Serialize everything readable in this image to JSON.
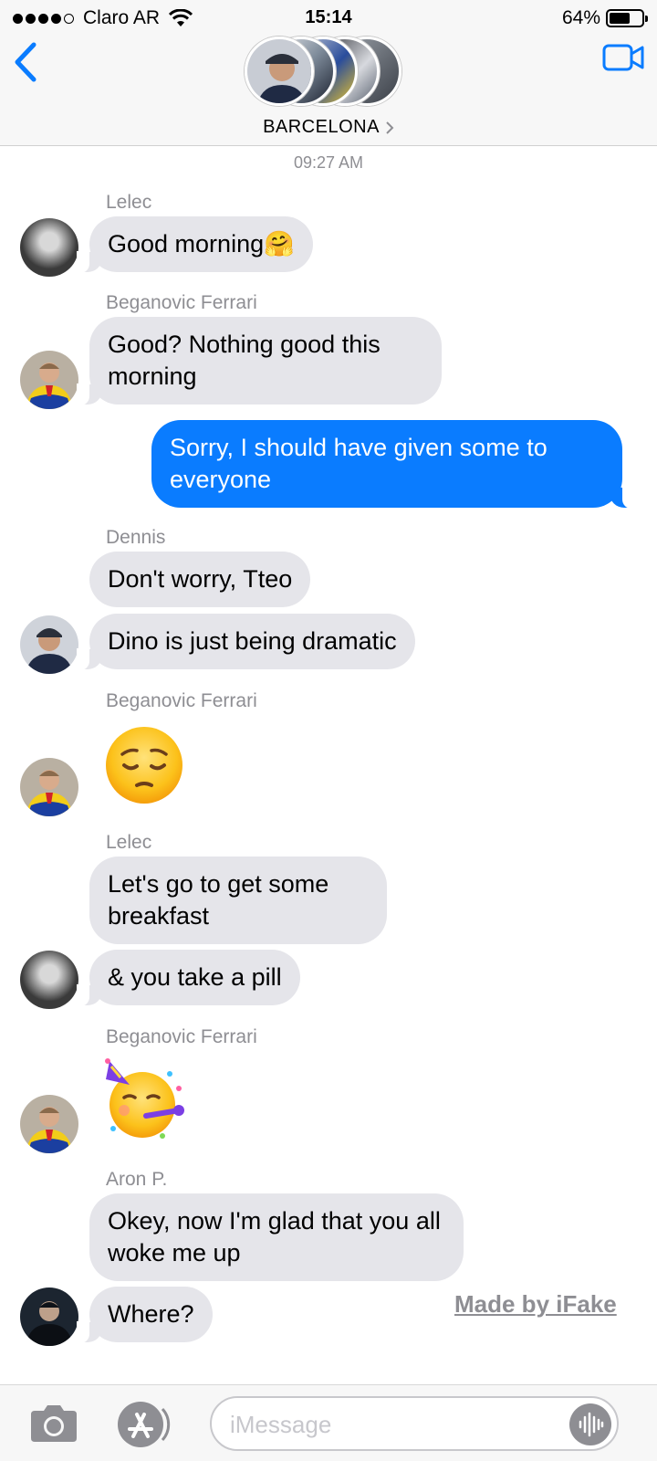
{
  "status_bar": {
    "carrier": "Claro AR",
    "time": "15:14",
    "battery": "64%",
    "battery_level": 0.64
  },
  "header": {
    "title": "BARCELONA",
    "back_icon": "chevron-left-icon",
    "video_icon": "video-camera-icon",
    "chevron_icon": "chevron-right-icon"
  },
  "chat": {
    "timestamp": "09:27 AM",
    "messages": [
      {
        "sender": "Lelec",
        "text": "Good morning🤗"
      },
      {
        "sender": "Beganovic Ferrari",
        "text": "Good? Nothing good this morning"
      },
      {
        "sender": "",
        "text": "Sorry, I should have given some to everyone",
        "outgoing": true
      },
      {
        "sender": "Dennis",
        "text": "Don't worry, Tteo"
      },
      {
        "sender": "",
        "text": "Dino is just being dramatic"
      },
      {
        "sender": "Beganovic Ferrari",
        "text": "",
        "emoji": "pensive-face"
      },
      {
        "sender": "Lelec",
        "text": "Let's go to get some breakfast"
      },
      {
        "sender": "",
        "text": "& you take a pill"
      },
      {
        "sender": "Beganovic Ferrari",
        "text": "",
        "emoji": "partying-face"
      },
      {
        "sender": "Aron P.",
        "text": "Okey, now I'm glad that you all woke me up"
      },
      {
        "sender": "",
        "text": "Where?"
      }
    ]
  },
  "watermark": "Made by iFake",
  "input_bar": {
    "placeholder": "iMessage",
    "camera_icon": "camera-icon",
    "apps_icon": "app-store-icon",
    "audio_icon": "audio-waveform-icon"
  },
  "colors": {
    "outgoing_bubble": "#0a7cff",
    "incoming_bubble": "#e5e5ea",
    "accent": "#0a7cff",
    "secondary_text": "#8e8e93"
  }
}
